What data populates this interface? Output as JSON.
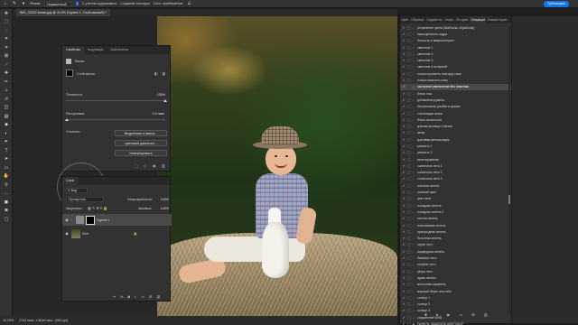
{
  "options_bar": {
    "mode_label": "Режим:",
    "mode_value": "Нормальный",
    "content_aware_label": "С учетом содержимого",
    "create_texture_label": "Создание текстуры",
    "sample_all_label": "Образец всех слоев",
    "diffusion_label": "Сосл. приближение",
    "publish_label": "Публикация"
  },
  "document": {
    "tab_title": "IMG_33222 копия.jpg @ 43,3% (Группа 1, Слой-маска/8) *"
  },
  "properties": {
    "tabs": [
      "Свойства",
      "Коррекция",
      "Библиотеки"
    ],
    "mask_section": "Маски",
    "layer_mask_label": "Слой-маска",
    "density_label": "Плотность:",
    "density_value": "100%",
    "feather_label": "Растушевка:",
    "feather_value": "0,0 пикс.",
    "refine_label": "Уточнить:",
    "select_mask_btn": "Выделение и маска...",
    "color_range_btn": "Цветовой диапазон...",
    "invert_btn": "Инвертировать"
  },
  "layers": {
    "title": "Слои",
    "filter_kind": "Вид",
    "blend_mode": "Пропустить",
    "opacity_label": "Непрозрачность:",
    "opacity_value": "100%",
    "lock_label": "Закрепить:",
    "fill_label": "Заливка:",
    "fill_value": "100%",
    "items": [
      {
        "name": "Группа 1"
      },
      {
        "name": "Фон"
      }
    ]
  },
  "actions_panel": {
    "tabs": [
      "Цвет",
      "Образцы",
      "Градиенты",
      "Узоры",
      "История",
      "Операции",
      "Комментарии"
    ],
    "active_tab": "Операции",
    "items": [
      "устранение цвета (Шаблоны обработки)",
      "насыщенность кадра",
      "Четкость и микроконтраст",
      "свечение 1",
      "свечение 2",
      "свечение 3",
      "свечение 4 вечерний",
      "только проявить текстуру кожи",
      "только смягчить кожу",
      "частичное увеличение без пластики",
      "блеск глаз",
      "добавляем румяна",
      "белоснежная улыбка и зрачки",
      "стилизация волос",
      "блеск на волосах",
      "красим ресницы и брови",
      "загар",
      "красивая детализация",
      "резкость 1",
      "резкость 2",
      "винетирование",
      "солнечное лето 1",
      "солнечное лето 2",
      "солнечное лето 3",
      "осенняя зелень",
      "осенний цвет",
      "цвет лета",
      "холодная зелень",
      "холодная зелень 2",
      "теплая зелень",
      "пластиковая зелень",
      "пригородная зелень",
      "болотная зелень",
      "серое лето",
      "изумрудная зелень",
      "бежевое лето",
      "голубое лето",
      "ретро лето",
      "яркая зелень",
      "молочная карамель",
      "морской берег или небо",
      "солнце 1",
      "солнце 2",
      "солнце 3",
      "сохранение WEB",
      "ПАНЕЛЬ ЭКШЕНОВ ЦВЕТОКОР",
      "ПАНЕЛЬ ЭКШЕНОВ ЦВЕТОКОР"
    ],
    "highlight_index": 9
  },
  "status": {
    "zoom": "43,29%",
    "dims": "3744 пикс. x 5616 пикс. (300 ppi)"
  }
}
